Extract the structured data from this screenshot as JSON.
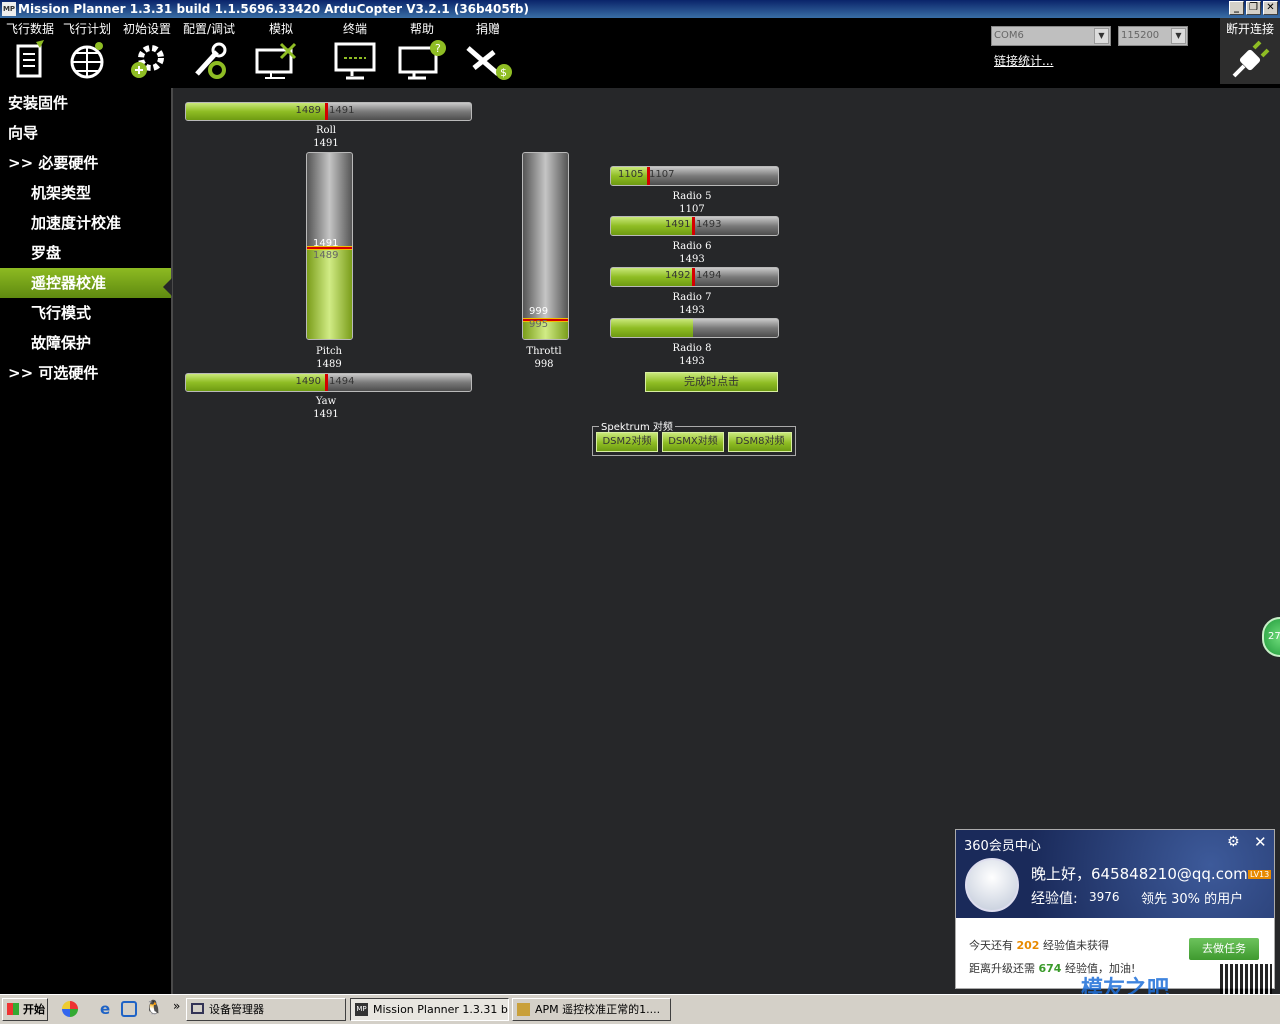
{
  "window": {
    "title": "Mission Planner 1.3.31 build 1.1.5696.33420 ArduCopter V3.2.1 (36b405fb)",
    "logo": "MP"
  },
  "toolbar": {
    "items": [
      {
        "label": "飞行数据",
        "icon": "flight-data-icon"
      },
      {
        "label": "飞行计划",
        "icon": "flight-plan-icon"
      },
      {
        "label": "初始设置",
        "icon": "initial-setup-icon"
      },
      {
        "label": "配置/调试",
        "icon": "config-tuning-icon"
      },
      {
        "label": "模拟",
        "icon": "simulation-icon"
      },
      {
        "label": "终端",
        "icon": "terminal-icon"
      },
      {
        "label": "帮助",
        "icon": "help-icon"
      },
      {
        "label": "捐赠",
        "icon": "donate-icon"
      }
    ],
    "port": "COM6",
    "baud": "115200",
    "stats_link": "链接统计...",
    "disconnect_label": "断开连接"
  },
  "sidebar": {
    "items": [
      {
        "label": "安装固件"
      },
      {
        "label": "向导"
      },
      {
        "label": ">> 必要硬件"
      },
      {
        "label": "机架类型"
      },
      {
        "label": "加速度计校准"
      },
      {
        "label": "罗盘"
      },
      {
        "label": "遥控器校准",
        "active": true
      },
      {
        "label": "飞行模式"
      },
      {
        "label": "故障保护"
      },
      {
        "label": ">> 可选硬件"
      }
    ]
  },
  "radio": {
    "roll": {
      "name": "Roll",
      "value": "1491",
      "left": "1489",
      "right": "1491",
      "fraction": 0.49
    },
    "pitch": {
      "name": "Pitch",
      "value": "1489",
      "top": "1491",
      "bottom": "1489",
      "fraction": 0.49
    },
    "yaw": {
      "name": "Yaw",
      "value": "1491",
      "left": "1490",
      "right": "1494",
      "fraction": 0.49
    },
    "throttle": {
      "name": "Throttl",
      "value": "998",
      "top": "999",
      "bottom": "995",
      "fraction": 0.1
    },
    "radio5": {
      "name": "Radio 5",
      "value": "1107",
      "left": "1105",
      "right": "1107",
      "fraction": 0.22
    },
    "radio6": {
      "name": "Radio 6",
      "value": "1493",
      "left": "1491",
      "right": "1493",
      "fraction": 0.49
    },
    "radio7": {
      "name": "Radio 7",
      "value": "1493",
      "left": "1492",
      "right": "1494",
      "fraction": 0.49
    },
    "radio8": {
      "name": "Radio 8",
      "value": "1493",
      "fraction": 0.49
    },
    "done_button": "完成时点击"
  },
  "spektrum": {
    "title": "Spektrum 对频",
    "buttons": [
      "DSM2对频",
      "DSMX对频",
      "DSM8对频"
    ]
  },
  "popup": {
    "title": "360会员中心",
    "greeting": "晚上好，645848210@qq.com",
    "level": "LV13",
    "exp_label": "经验值:",
    "exp_value": "3976",
    "exp_rank": "领先 30% 的用户",
    "line1_pre": "今天还有",
    "line1_num": "202",
    "line1_post": "经验值未获得",
    "line2_pre": "距离升级还需",
    "line2_num": "674",
    "line2_post": "经验值，加油!",
    "task_button": "去做任务",
    "watermark": "模友之吧"
  },
  "side_badge": "27",
  "taskbar": {
    "start": "开始",
    "tasks": [
      "设备管理器",
      "Mission Planner 1.3.31 b...",
      "APM 遥控校准正常的1...."
    ]
  },
  "colors": {
    "accent": "#8fbd24",
    "marker": "#d40000",
    "background": "#262729"
  }
}
